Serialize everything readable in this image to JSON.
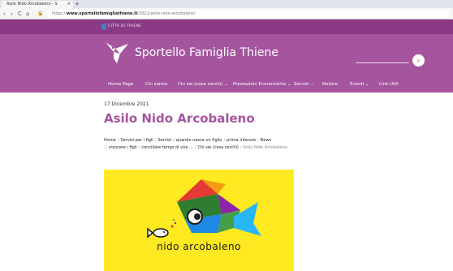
{
  "browser": {
    "tab_title": "Asilo Nido Arcobaleno - S",
    "tab_close": "×",
    "new_tab": "+",
    "back": "‹",
    "forward": "›",
    "reload": "C",
    "home": "⌂",
    "url_domain": "www.sportellofamigliathiene.it",
    "url_prefix": "https://",
    "url_path": "/2021/asilo-nido-arcobaleno/"
  },
  "site": {
    "city_label": "CITTÀ DI THIENE",
    "title": "Sportello Famiglia Thiene",
    "search_icon": "⌕",
    "accent_color": "#a4559e"
  },
  "menu": {
    "items": [
      "Home Page",
      "Chi siamo",
      "Chi sei (cosa cerchi) ⌄",
      "Prestazioni Economiche ⌄",
      "Servizi ⌄",
      "Notizie",
      "Eventi ⌄",
      "Link Utili"
    ]
  },
  "article": {
    "date": "17 Dicembre 2021",
    "title": "Asilo Nido Arcobaleno",
    "breadcrumb": [
      "Home",
      "Servizi per i figli",
      "Servizi",
      "quando nasce un figlio",
      "prima infanzia",
      "News",
      "crescere i figli",
      "conciliare tempi di vita ...",
      "Chi sei (cosa cerchi)",
      "Asilo Nido Arcobaleno"
    ],
    "breadcrumb_sep": "/",
    "image_caption": "nido arcobaleno"
  }
}
